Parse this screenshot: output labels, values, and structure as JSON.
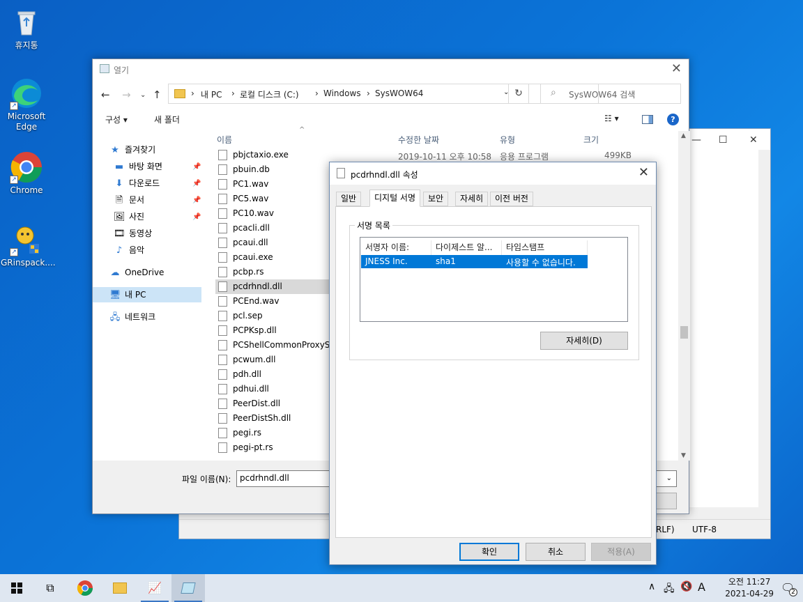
{
  "desktop": {
    "icons": [
      {
        "label": "휴지통"
      },
      {
        "label": "Microsoft Edge"
      },
      {
        "label": "Chrome"
      },
      {
        "label": "GRinspack...."
      }
    ]
  },
  "notepad": {
    "status_line_ending": "RLF)",
    "status_encoding": "UTF-8"
  },
  "open_dialog": {
    "title": "열기",
    "breadcrumb": [
      "내 PC",
      "로컬 디스크 (C:)",
      "Windows",
      "SysWOW64"
    ],
    "search_placeholder": "SysWOW64 검색",
    "toolbar": {
      "organize": "구성 ▾",
      "new_folder": "새 폴더"
    },
    "nav": {
      "quick_access": "즐겨찾기",
      "desktop": "바탕 화면",
      "downloads": "다운로드",
      "documents": "문서",
      "pictures": "사진",
      "videos": "동영상",
      "music": "음악",
      "onedrive": "OneDrive",
      "this_pc": "내 PC",
      "network": "네트워크"
    },
    "columns": {
      "name": "이름",
      "modified": "수정한 날짜",
      "type": "유형",
      "size": "크기"
    },
    "files": [
      {
        "name": "pbjctaxio.exe",
        "modified": "2019-10-11 오후 10:58",
        "type": "응용 프로그램",
        "size": "499KB"
      },
      {
        "name": "pbuin.db"
      },
      {
        "name": "PC1.wav"
      },
      {
        "name": "PC5.wav"
      },
      {
        "name": "PC10.wav"
      },
      {
        "name": "pcacli.dll"
      },
      {
        "name": "pcaui.dll"
      },
      {
        "name": "pcaui.exe"
      },
      {
        "name": "pcbp.rs"
      },
      {
        "name": "pcdrhndl.dll"
      },
      {
        "name": "PCEnd.wav"
      },
      {
        "name": "pcl.sep"
      },
      {
        "name": "PCPKsp.dll"
      },
      {
        "name": "PCShellCommonProxyStub.dll"
      },
      {
        "name": "pcwum.dll"
      },
      {
        "name": "pdh.dll"
      },
      {
        "name": "pdhui.dll"
      },
      {
        "name": "PeerDist.dll"
      },
      {
        "name": "PeerDistSh.dll"
      },
      {
        "name": "pegi.rs"
      },
      {
        "name": "pegi-pt.rs"
      }
    ],
    "filename_label": "파일 이름(N):",
    "filename_value": "pcdrhndl.dll"
  },
  "properties": {
    "title": "pcdrhndl.dll 속성",
    "tabs": [
      "일반",
      "디지털 서명",
      "보안",
      "자세히",
      "이전 버전"
    ],
    "group_label": "서명 목록",
    "list_headers": [
      "서명자 이름:",
      "다이제스트 알...",
      "타임스탬프"
    ],
    "signatures": [
      {
        "signer": "JNESS Inc.",
        "digest": "sha1",
        "timestamp": "사용할 수 없습니다."
      }
    ],
    "details_button": "자세히(D)",
    "ok": "확인",
    "cancel": "취소",
    "apply": "적용(A)"
  },
  "taskbar": {
    "time": "오전 11:27",
    "date": "2021-04-29",
    "ime": "A",
    "notification_count": "2"
  }
}
